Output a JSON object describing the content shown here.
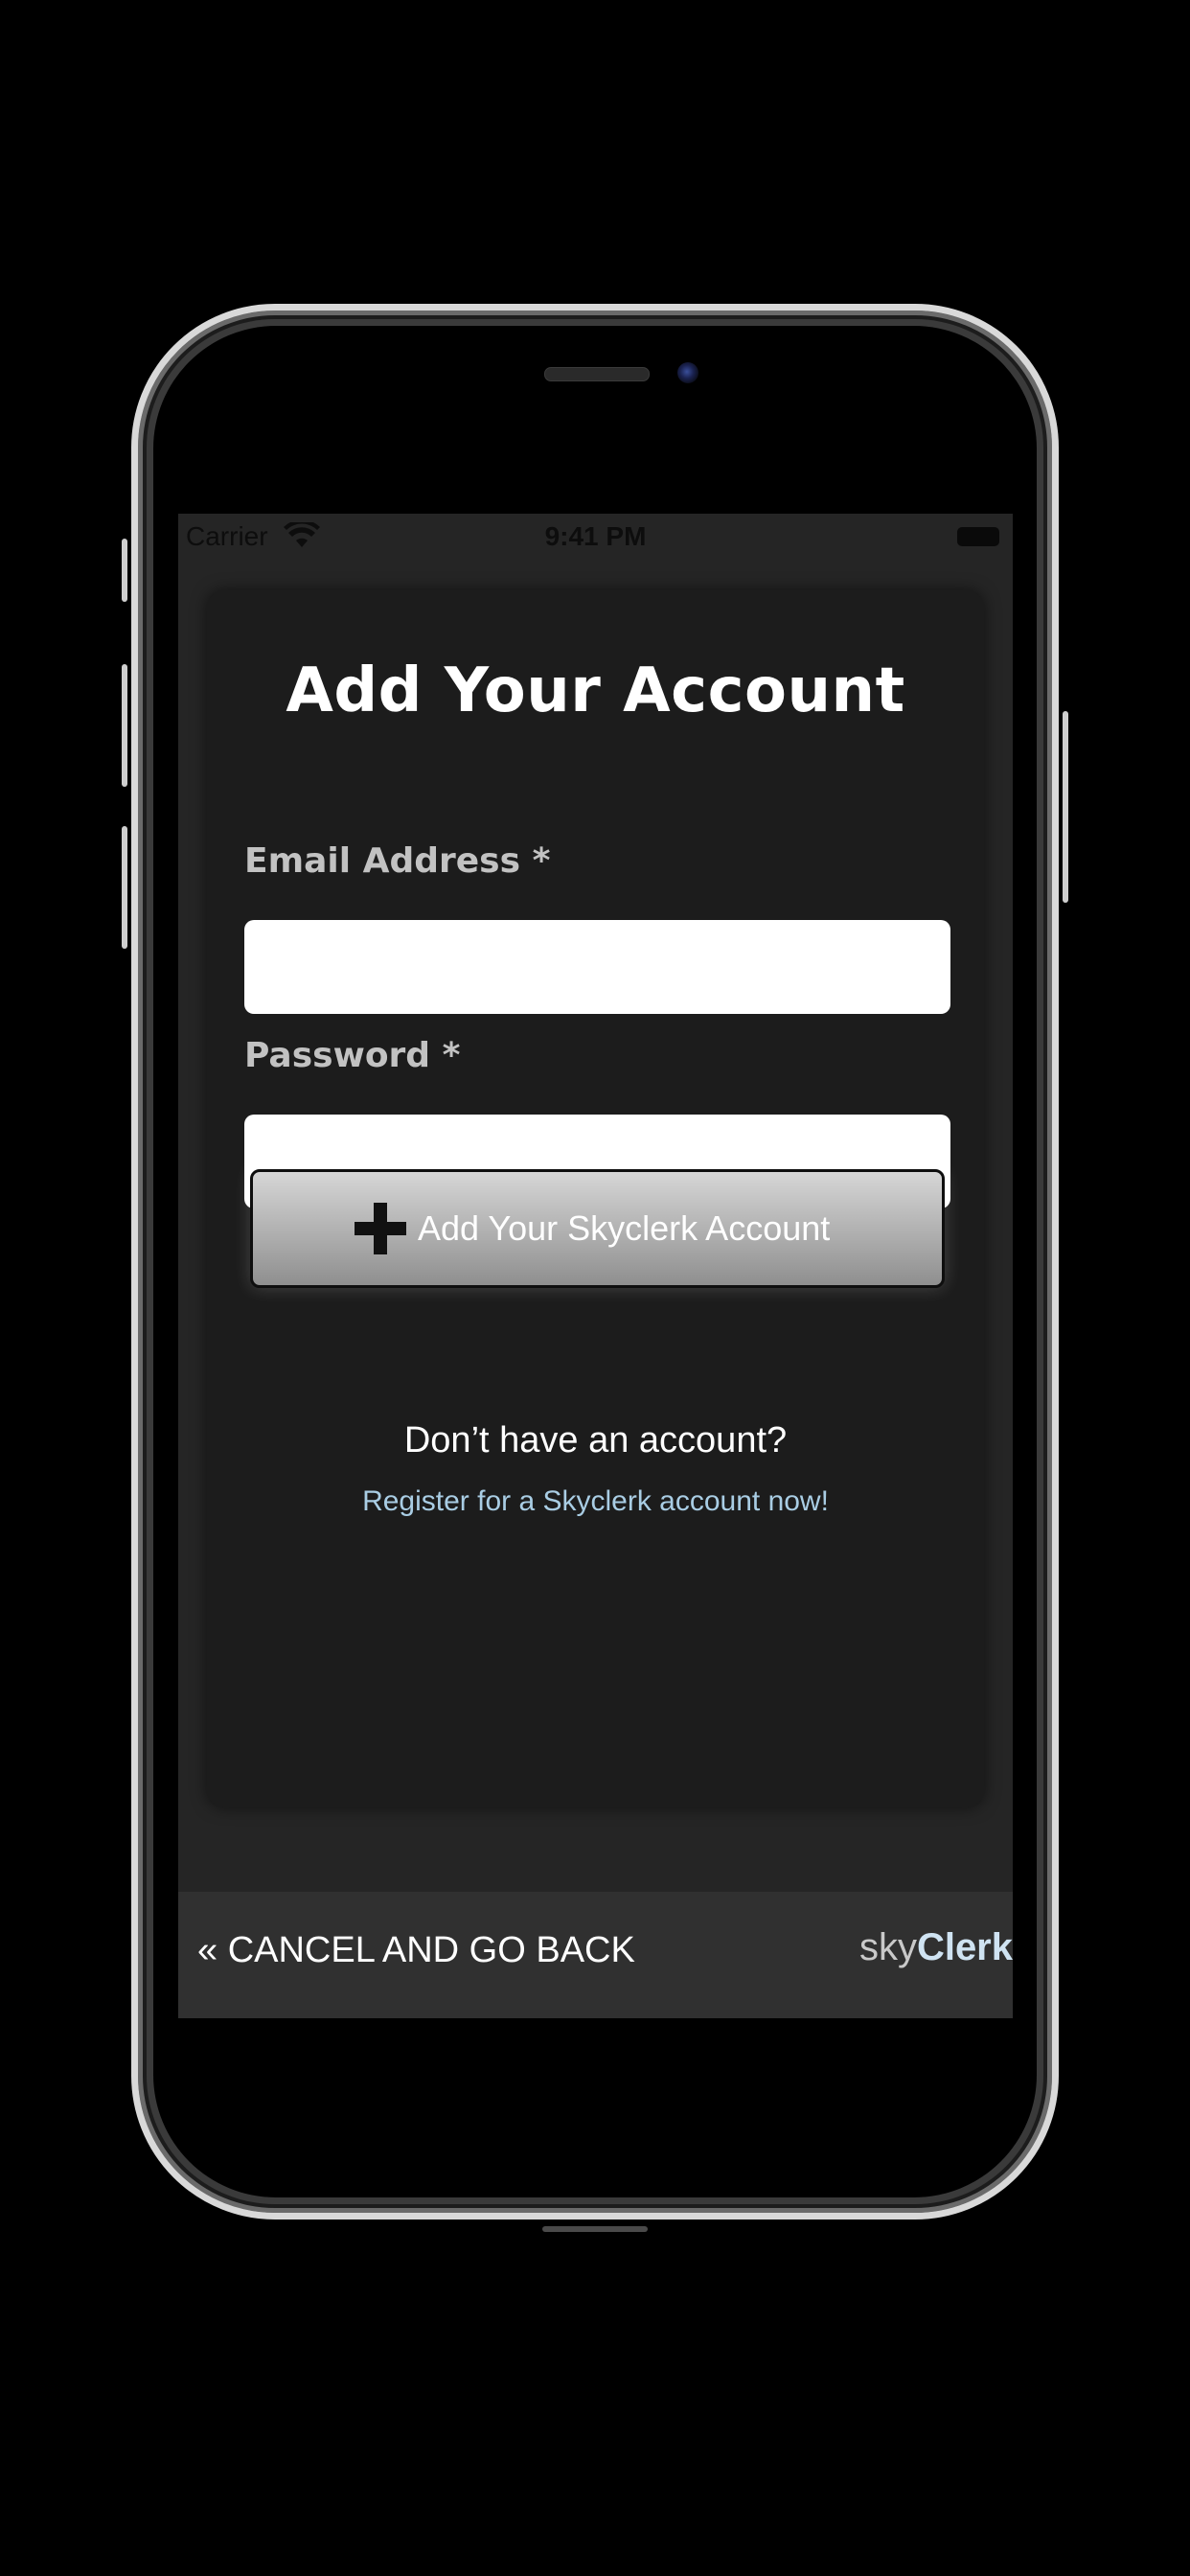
{
  "status_bar": {
    "carrier": "Carrier",
    "time": "9:41 PM",
    "wifi_icon": "wifi-icon",
    "battery_icon": "battery-icon"
  },
  "form": {
    "title": "Add Your Account",
    "email_label": "Email Address *",
    "email_value": "",
    "email_placeholder": "",
    "password_label": "Password *",
    "password_value": "",
    "password_placeholder": "",
    "submit_icon": "plus-icon",
    "submit_label": "Add Your Skyclerk Account"
  },
  "register": {
    "prompt": "Don’t have an account?",
    "link_text": "Register for a Skyclerk account now!"
  },
  "bottom_bar": {
    "cancel_label": "« CANCEL AND GO BACK",
    "logo_part1": "sky",
    "logo_part2": "Clerk"
  },
  "colors": {
    "background": "#000000",
    "screen": "#252525",
    "card": "#1c1c1c",
    "bottom_bar": "#303030",
    "link": "#a9cde4",
    "label": "#c2c2c2"
  }
}
